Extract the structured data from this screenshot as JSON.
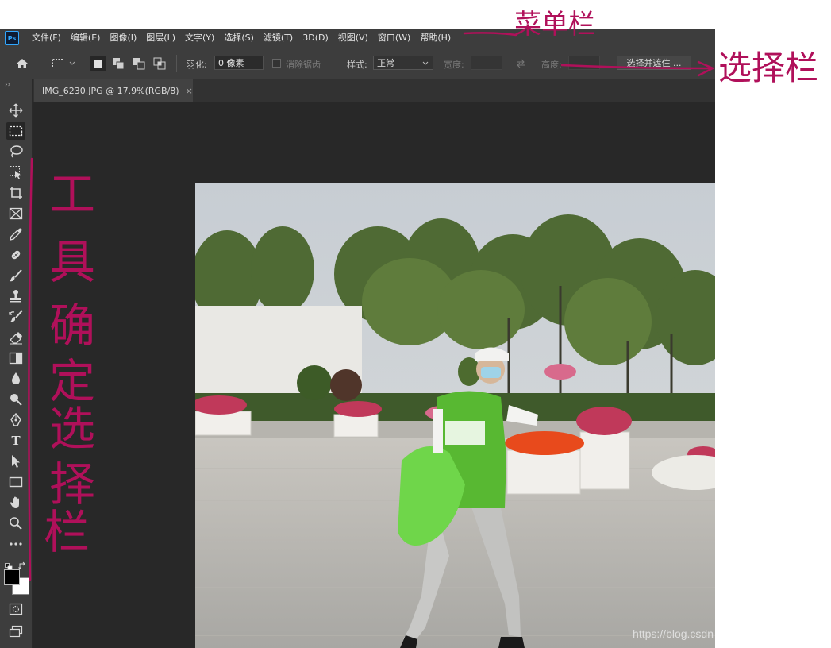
{
  "app": {
    "logo": "Ps"
  },
  "menu": [
    "文件(F)",
    "编辑(E)",
    "图像(I)",
    "图层(L)",
    "文字(Y)",
    "选择(S)",
    "滤镜(T)",
    "3D(D)",
    "视图(V)",
    "窗口(W)",
    "帮助(H)"
  ],
  "options": {
    "feather_label": "羽化:",
    "feather_value": "0 像素",
    "antialias_label": "消除锯齿",
    "style_label": "样式:",
    "style_value": "正常",
    "width_label": "宽度:",
    "height_label": "高度:",
    "select_mask_label": "选择并遮住 ..."
  },
  "document": {
    "tab_title": "IMG_6230.JPG @ 17.9%(RGB/8)",
    "close_glyph": "×"
  },
  "watermark": "https://blog.csdn",
  "annotations": {
    "menu_bar": "菜单栏",
    "options_bar": "选择栏",
    "toolbar": "工具确定选择栏"
  },
  "colors": {
    "annotation": "#b0105a",
    "ps_blue": "#31a8ff"
  }
}
